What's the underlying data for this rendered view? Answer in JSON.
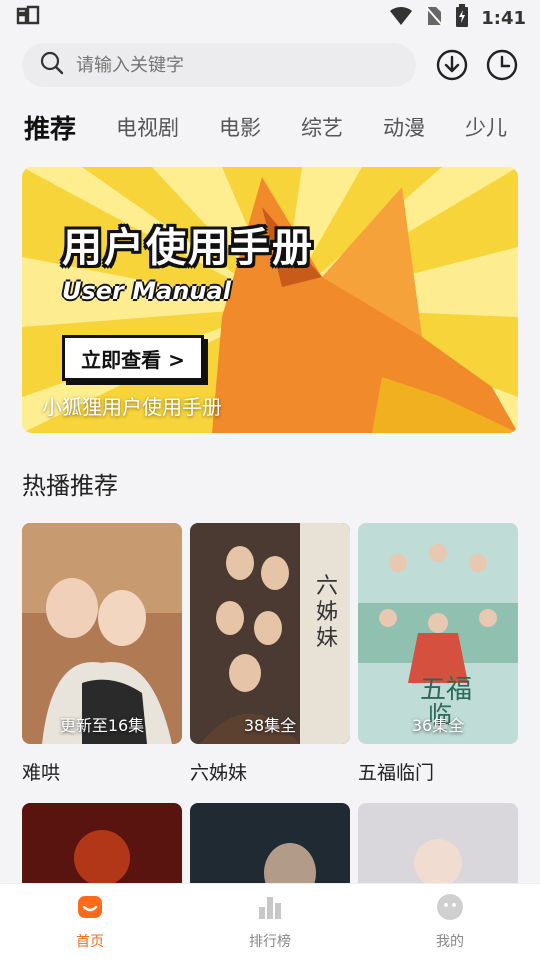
{
  "status": {
    "left_icon": "bug-logo-icon",
    "time": "1:41"
  },
  "search": {
    "placeholder": "请输入关键字"
  },
  "top_actions": {
    "download_icon": "download-icon",
    "history_icon": "history-icon"
  },
  "tabs": [
    {
      "label": "推荐",
      "active": true
    },
    {
      "label": "电视剧"
    },
    {
      "label": "电影"
    },
    {
      "label": "综艺"
    },
    {
      "label": "动漫"
    },
    {
      "label": "少儿"
    }
  ],
  "banner": {
    "title": "用户使用手册",
    "subtitle": "User Manual",
    "button": "立即查看 >",
    "caption": "小狐狸用户使用手册"
  },
  "section": {
    "title": "热播推荐"
  },
  "cards": [
    {
      "title": "难哄",
      "badge": "更新至16集",
      "color": "#b07a55"
    },
    {
      "title": "六姊妹",
      "badge": "38集全",
      "color": "#4a3a32"
    },
    {
      "title": "五福临门",
      "badge": "36集全",
      "color": "#9fc7c0"
    }
  ],
  "more_cards": [
    {
      "color": "#5a1410"
    },
    {
      "color": "#1f2a33"
    },
    {
      "color": "#d9d6dc"
    }
  ],
  "nav": [
    {
      "label": "首页",
      "icon": "home-icon",
      "active": true
    },
    {
      "label": "排行榜",
      "icon": "ranking-icon"
    },
    {
      "label": "我的",
      "icon": "profile-icon"
    }
  ],
  "colors": {
    "accent": "#ff6a1a",
    "banner_bg": "#f7d43a"
  }
}
